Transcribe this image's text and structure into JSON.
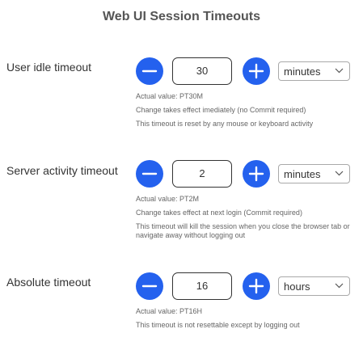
{
  "page": {
    "title": "Web UI Session Timeouts"
  },
  "sections": [
    {
      "label": "User idle timeout",
      "value": "30",
      "unit": "minutes",
      "notes": [
        "Actual value: PT30M",
        "Change takes effect imediately (no Commit required)",
        "This timeout is reset by any mouse or keyboard activity"
      ]
    },
    {
      "label": "Server activity timeout",
      "value": "2",
      "unit": "minutes",
      "notes": [
        "Actual value: PT2M",
        "Change takes effect at next login (Commit required)",
        "This timeout will kill the session when you close the browser tab or navigate away without logging out"
      ]
    },
    {
      "label": "Absolute timeout",
      "value": "16",
      "unit": "hours",
      "notes": [
        "Actual value: PT16H",
        "This timeout is not resettable except by logging out"
      ]
    }
  ],
  "icons": {
    "decrement": "minus-icon",
    "increment": "plus-icon",
    "dropdown": "chevron-down-icon"
  },
  "colors": {
    "accent": "#2461ee",
    "title": "#555555",
    "note_text": "#666666"
  }
}
